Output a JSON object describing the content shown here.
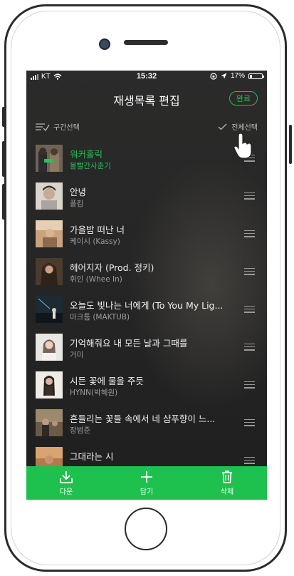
{
  "status_bar": {
    "carrier": "KT",
    "time": "15:32",
    "battery_percent": "17%",
    "battery_level": 0.17
  },
  "header": {
    "title": "재생목록 편집",
    "done_label": "완료"
  },
  "toolbar": {
    "range_select_label": "구간선택",
    "select_all_label": "전체선택"
  },
  "songs": [
    {
      "title": "워커홀릭",
      "artist": "볼빨간사춘기",
      "playing": true
    },
    {
      "title": "안녕",
      "artist": "폴킴",
      "playing": false
    },
    {
      "title": "가을밤 떠난 너",
      "artist": "케이시 (Kassy)",
      "playing": false
    },
    {
      "title": "헤어지자 (Prod. 정키)",
      "artist": "휘인 (Whee In)",
      "playing": false
    },
    {
      "title": "오늘도 빛나는 너에게 (To You My Lig...",
      "artist": "마크툽 (MAKTUB)",
      "playing": false
    },
    {
      "title": "기억해줘요 내 모든 날과 그때를",
      "artist": "거미",
      "playing": false
    },
    {
      "title": "시든 꽃에 물을 주듯",
      "artist": "HYNN(박혜원)",
      "playing": false
    },
    {
      "title": "흔들리는 꽃들 속에서 네 샴푸향이 느...",
      "artist": "장범준",
      "playing": false
    },
    {
      "title": "그대라는 시",
      "artist": "",
      "playing": false
    }
  ],
  "bottom_bar": {
    "download_label": "다운",
    "add_label": "담기",
    "delete_label": "삭제"
  },
  "colors": {
    "accent": "#1ec14e",
    "background": "#262626"
  }
}
